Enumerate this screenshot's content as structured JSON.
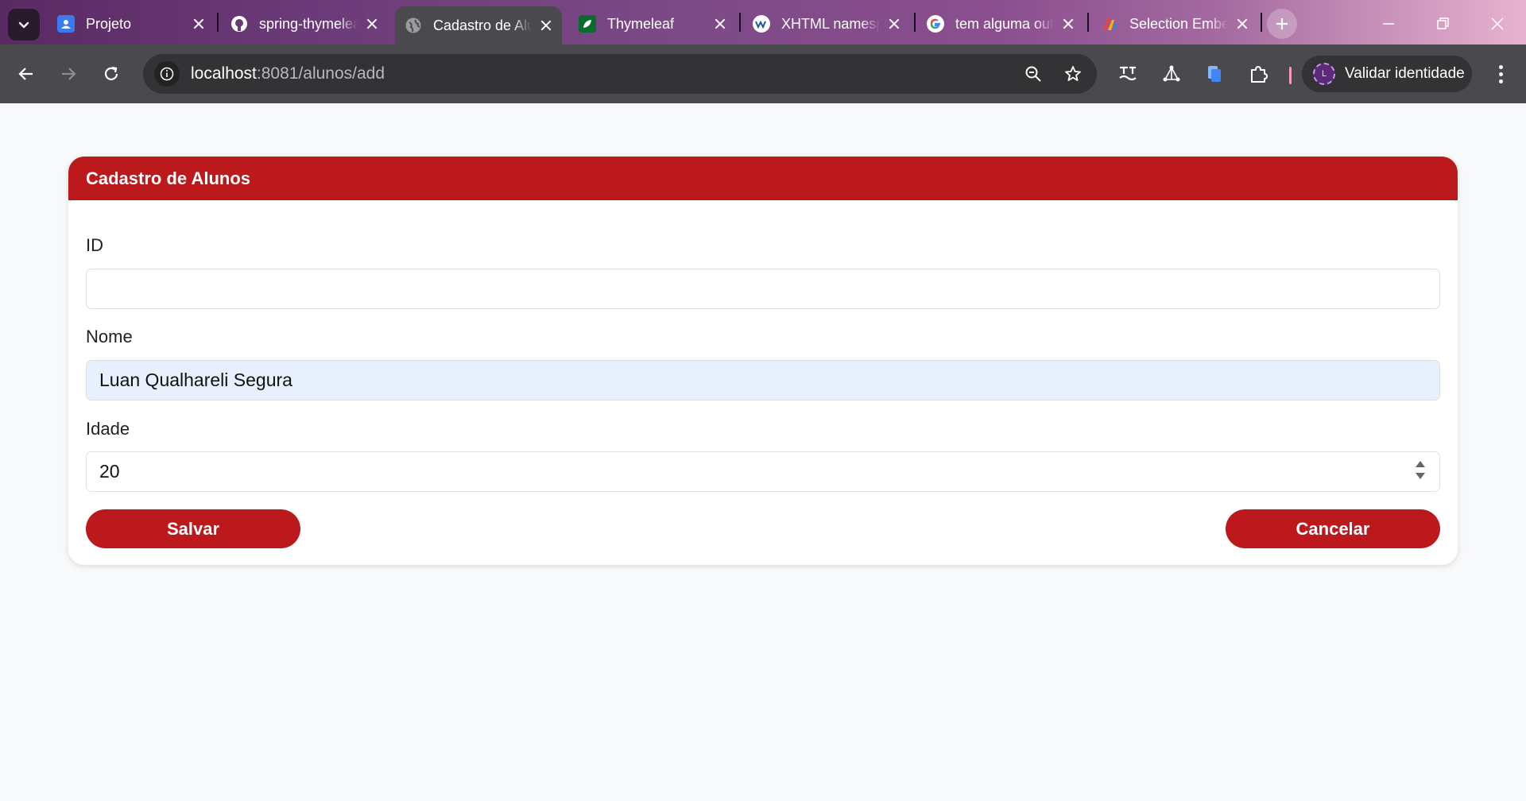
{
  "browser": {
    "tabs": [
      {
        "title": "Projeto",
        "icon": "contact-card-icon"
      },
      {
        "title": "spring-thymeleaf",
        "icon": "github-icon"
      },
      {
        "title": "Cadastro de Alunos",
        "icon": "globe-icon",
        "active": true
      },
      {
        "title": "Thymeleaf",
        "icon": "thymeleaf-leaf-icon"
      },
      {
        "title": "XHTML namespace",
        "icon": "w3c-icon"
      },
      {
        "title": "tem alguma outra",
        "icon": "google-icon"
      },
      {
        "title": "Selection Embedded",
        "icon": "gradient-logo-icon"
      }
    ],
    "address": {
      "host": "localhost",
      "rest": ":8081/alunos/add"
    },
    "profile_label": "Validar identidade",
    "profile_initial": "L"
  },
  "form": {
    "title": "Cadastro de Alunos",
    "fields": [
      {
        "label": "ID",
        "value": ""
      },
      {
        "label": "Nome",
        "value": "Luan Qualhareli Segura"
      },
      {
        "label": "Idade",
        "value": "20"
      }
    ],
    "save_label": "Salvar",
    "cancel_label": "Cancelar"
  },
  "colors": {
    "accent": "#bb191c",
    "autofill": "#e8f0fe",
    "page_bg": "#f8f9fb"
  }
}
